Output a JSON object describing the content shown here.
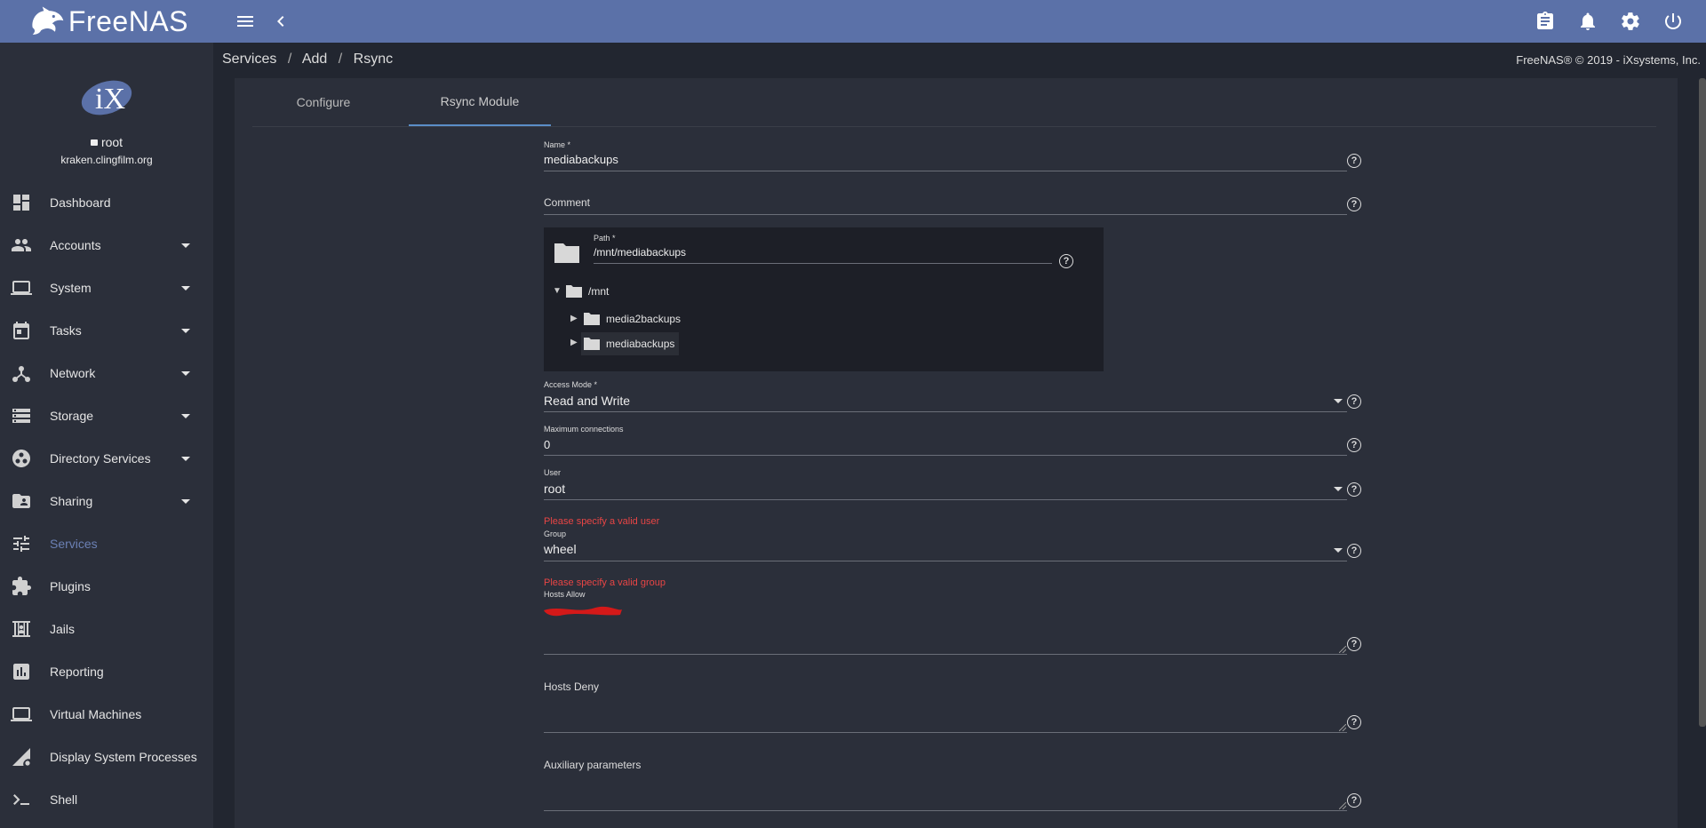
{
  "app": {
    "brand": "FreeNAS"
  },
  "topbar": {
    "menu_icon": "menu-icon",
    "back_icon": "chevron-left-icon",
    "icons": [
      "clipboard-icon",
      "bell-icon",
      "gear-icon",
      "power-icon"
    ]
  },
  "profile": {
    "user": "root",
    "host": "kraken.clingfilm.org"
  },
  "nav": [
    {
      "label": "Dashboard",
      "icon": "dashboard-icon",
      "caret": false,
      "active": false
    },
    {
      "label": "Accounts",
      "icon": "people-icon",
      "caret": true,
      "active": false
    },
    {
      "label": "System",
      "icon": "laptop-icon",
      "caret": true,
      "active": false
    },
    {
      "label": "Tasks",
      "icon": "calendar-icon",
      "caret": true,
      "active": false
    },
    {
      "label": "Network",
      "icon": "network-icon",
      "caret": true,
      "active": false
    },
    {
      "label": "Storage",
      "icon": "storage-icon",
      "caret": true,
      "active": false
    },
    {
      "label": "Directory Services",
      "icon": "directory-icon",
      "caret": true,
      "active": false
    },
    {
      "label": "Sharing",
      "icon": "folder-shared-icon",
      "caret": true,
      "active": false
    },
    {
      "label": "Services",
      "icon": "tune-icon",
      "caret": false,
      "active": true
    },
    {
      "label": "Plugins",
      "icon": "puzzle-icon",
      "caret": false,
      "active": false
    },
    {
      "label": "Jails",
      "icon": "jail-icon",
      "caret": false,
      "active": false
    },
    {
      "label": "Reporting",
      "icon": "chart-icon",
      "caret": false,
      "active": false
    },
    {
      "label": "Virtual Machines",
      "icon": "laptop-icon",
      "caret": false,
      "active": false
    },
    {
      "label": "Display System Processes",
      "icon": "processes-icon",
      "caret": false,
      "active": false
    },
    {
      "label": "Shell",
      "icon": "terminal-icon",
      "caret": false,
      "active": false
    }
  ],
  "breadcrumb": {
    "items": [
      "Services",
      "Add",
      "Rsync"
    ],
    "separator": "/"
  },
  "copyright": "FreeNAS® © 2019 - iXsystems, Inc.",
  "tabs": {
    "configure": "Configure",
    "module": "Rsync Module"
  },
  "form": {
    "name": {
      "label": "Name *",
      "value": "mediabackups"
    },
    "comment": {
      "label": "Comment",
      "value": ""
    },
    "path": {
      "label": "Path *",
      "value": "/mnt/mediabackups"
    },
    "tree": {
      "root": "/mnt",
      "children": [
        "media2backups",
        "mediabackups"
      ]
    },
    "access_mode": {
      "label": "Access Mode *",
      "value": "Read and Write"
    },
    "max_connections": {
      "label": "Maximum connections",
      "value": "0"
    },
    "user": {
      "label": "User",
      "value": "root",
      "error": "Please specify a valid user"
    },
    "group": {
      "label": "Group",
      "value": "wheel",
      "error": "Please specify a valid group"
    },
    "hosts_allow": {
      "label": "Hosts Allow"
    },
    "hosts_deny": {
      "label": "Hosts Deny"
    },
    "aux": {
      "label": "Auxiliary parameters"
    },
    "help_glyph": "?"
  },
  "colors": {
    "topbar": "#5b71a8",
    "sidebar": "#2b2f3a",
    "accent": "#6b80b4",
    "error": "#e84545",
    "tab_indicator": "#5b8ec8"
  }
}
